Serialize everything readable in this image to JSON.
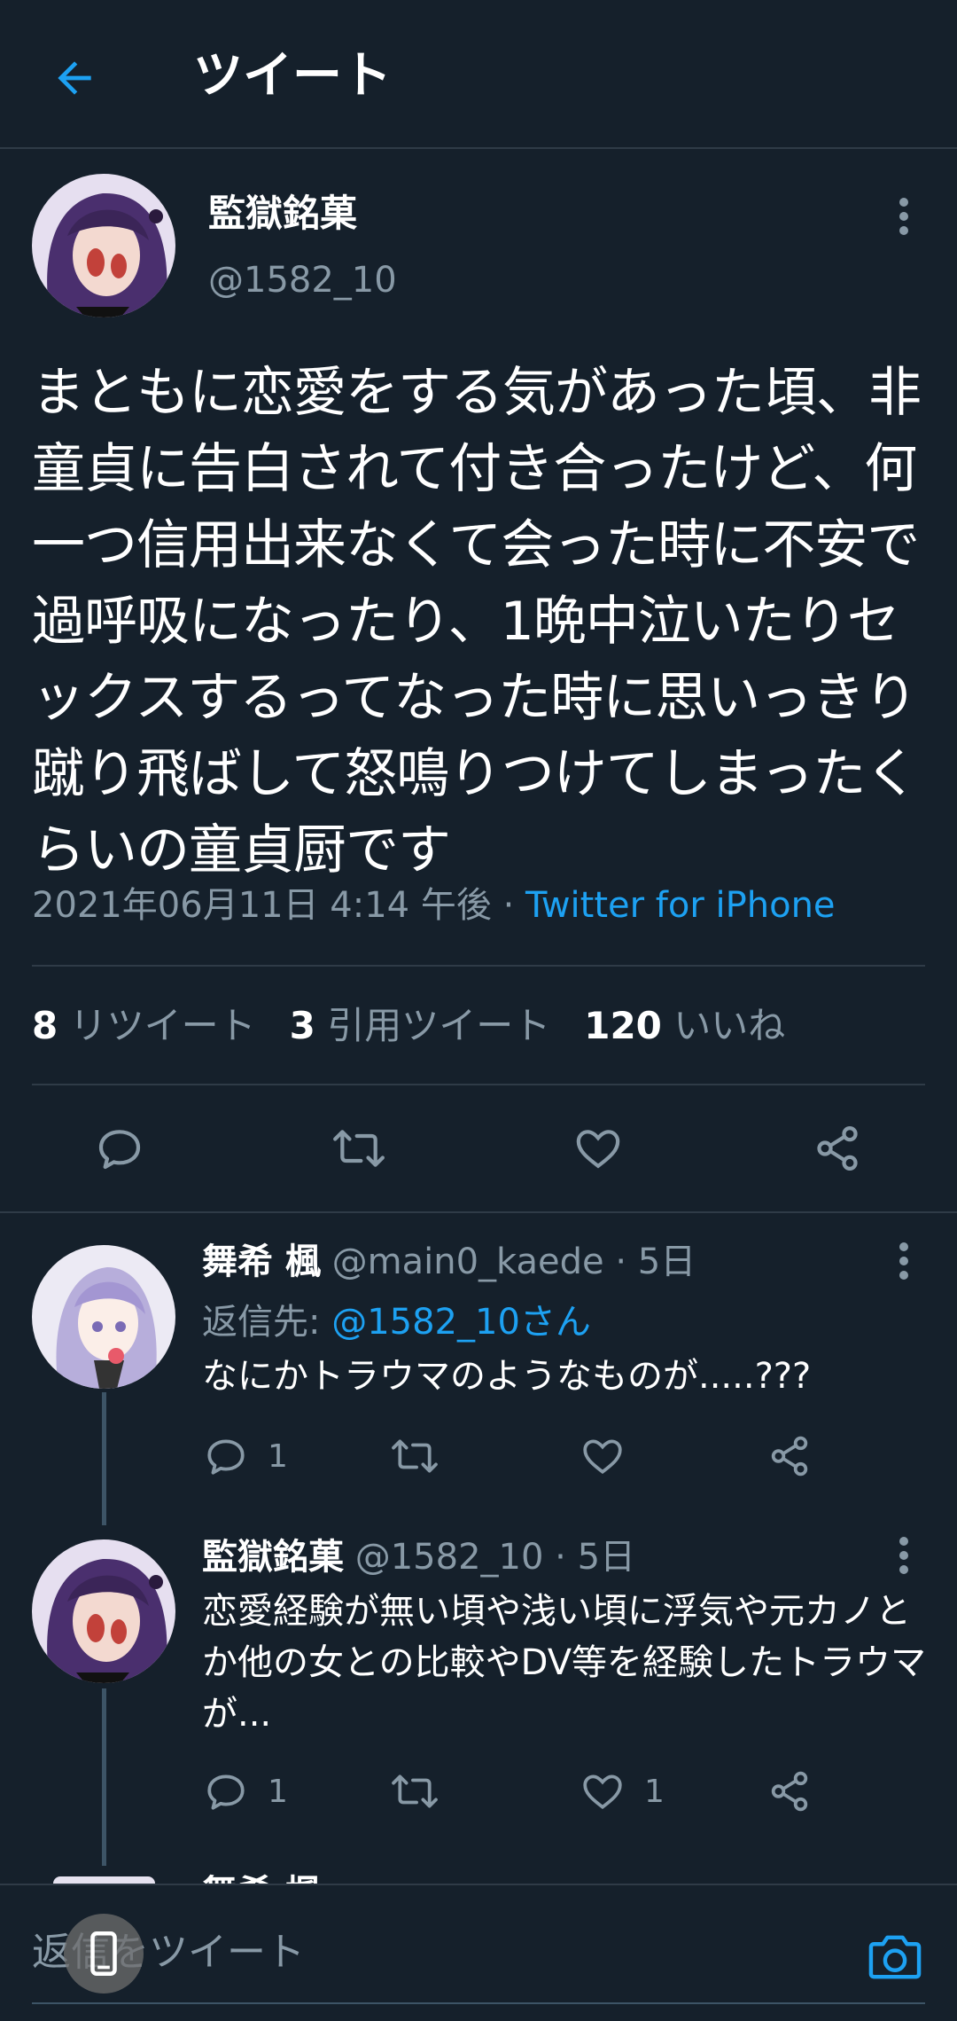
{
  "header": {
    "title": "ツイート"
  },
  "tweet": {
    "author_name": "監獄銘菓",
    "author_handle": "@1582_10",
    "text": "まともに恋愛をする気があった頃、非童貞に告白されて付き合ったけど、何一つ信用出来なくて会った時に不安で過呼吸になったり、1晩中泣いたりセックスするってなった時に思いっきり蹴り飛ばして怒鳴りつけてしまったくらいの童貞厨です",
    "timestamp": "2021年06月11日 4:14 午後",
    "separator": " · ",
    "source": "Twitter for iPhone",
    "retweets_count": "8",
    "retweets_label": "リツイート",
    "quotes_count": "3",
    "quotes_label": "引用ツイート",
    "likes_count": "120",
    "likes_label": "いいね"
  },
  "replies": [
    {
      "name": "舞希 楓",
      "handle": "@main0_kaede",
      "time": "5日",
      "reply_to_label": "返信先: ",
      "reply_to_mention": "@1582_10さん",
      "text": "なにかトラウマのようなものが.....???",
      "reply_count": "1",
      "retweet_count": "",
      "like_count": ""
    },
    {
      "name": "監獄銘菓",
      "handle": "@1582_10",
      "time": "5日",
      "text": "恋愛経験が無い頃や浅い頃に浮気や元カノとか他の女との比較やDV等を経験したトラウマが...",
      "reply_count": "1",
      "retweet_count": "",
      "like_count": "1"
    }
  ],
  "peek_reply": {
    "name": "舞希 楓"
  },
  "compose": {
    "placeholder": "返信をツイート"
  },
  "colors": {
    "background": "#15202b",
    "accent": "#1da1f2",
    "muted": "#8899a6",
    "divider": "#2f3b47"
  },
  "icons": [
    "back-arrow-icon",
    "more-vertical-icon",
    "reply-icon",
    "retweet-icon",
    "like-icon",
    "share-icon",
    "camera-icon",
    "phone-icon"
  ]
}
